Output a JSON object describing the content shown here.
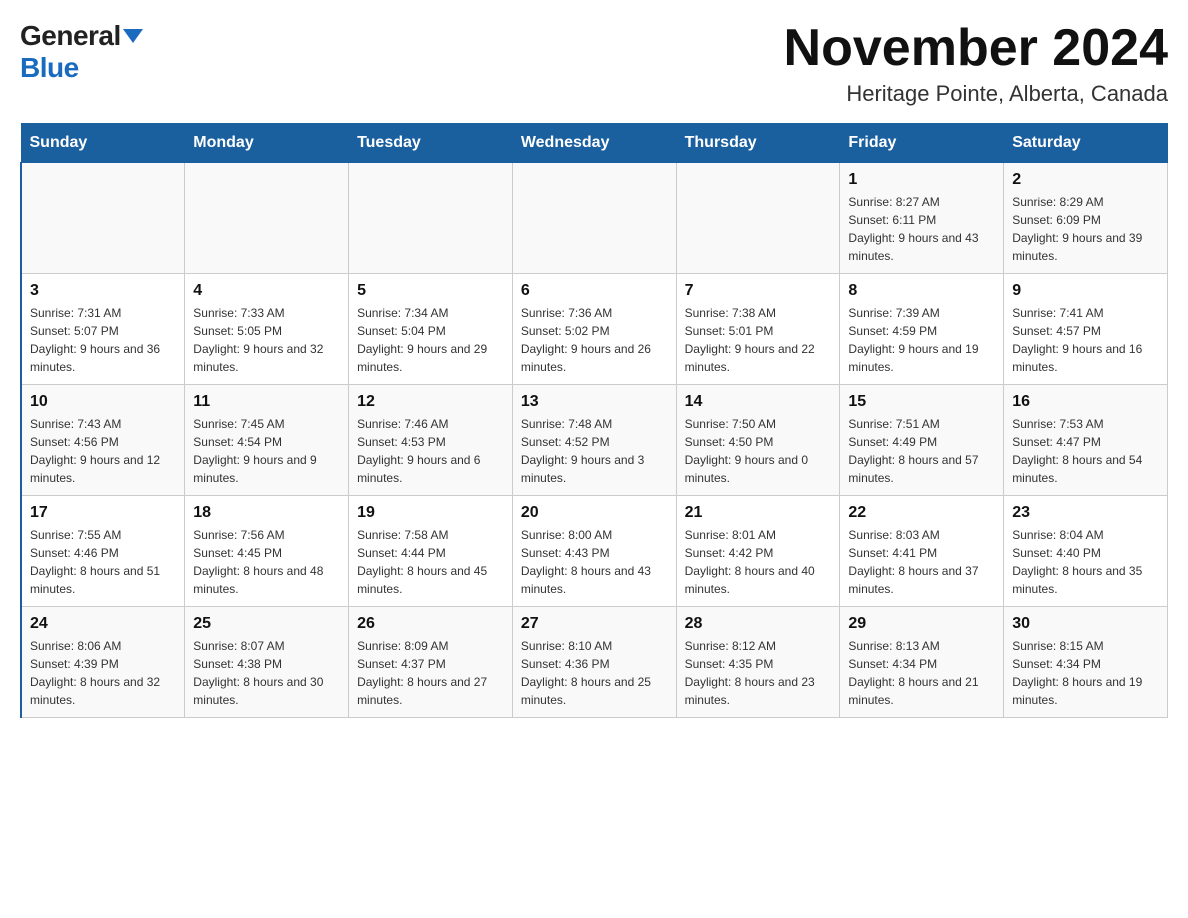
{
  "logo": {
    "general": "General",
    "blue": "Blue"
  },
  "header": {
    "month_year": "November 2024",
    "location": "Heritage Pointe, Alberta, Canada"
  },
  "weekdays": [
    "Sunday",
    "Monday",
    "Tuesday",
    "Wednesday",
    "Thursday",
    "Friday",
    "Saturday"
  ],
  "weeks": [
    [
      {
        "day": "",
        "info": ""
      },
      {
        "day": "",
        "info": ""
      },
      {
        "day": "",
        "info": ""
      },
      {
        "day": "",
        "info": ""
      },
      {
        "day": "",
        "info": ""
      },
      {
        "day": "1",
        "info": "Sunrise: 8:27 AM\nSunset: 6:11 PM\nDaylight: 9 hours and 43 minutes."
      },
      {
        "day": "2",
        "info": "Sunrise: 8:29 AM\nSunset: 6:09 PM\nDaylight: 9 hours and 39 minutes."
      }
    ],
    [
      {
        "day": "3",
        "info": "Sunrise: 7:31 AM\nSunset: 5:07 PM\nDaylight: 9 hours and 36 minutes."
      },
      {
        "day": "4",
        "info": "Sunrise: 7:33 AM\nSunset: 5:05 PM\nDaylight: 9 hours and 32 minutes."
      },
      {
        "day": "5",
        "info": "Sunrise: 7:34 AM\nSunset: 5:04 PM\nDaylight: 9 hours and 29 minutes."
      },
      {
        "day": "6",
        "info": "Sunrise: 7:36 AM\nSunset: 5:02 PM\nDaylight: 9 hours and 26 minutes."
      },
      {
        "day": "7",
        "info": "Sunrise: 7:38 AM\nSunset: 5:01 PM\nDaylight: 9 hours and 22 minutes."
      },
      {
        "day": "8",
        "info": "Sunrise: 7:39 AM\nSunset: 4:59 PM\nDaylight: 9 hours and 19 minutes."
      },
      {
        "day": "9",
        "info": "Sunrise: 7:41 AM\nSunset: 4:57 PM\nDaylight: 9 hours and 16 minutes."
      }
    ],
    [
      {
        "day": "10",
        "info": "Sunrise: 7:43 AM\nSunset: 4:56 PM\nDaylight: 9 hours and 12 minutes."
      },
      {
        "day": "11",
        "info": "Sunrise: 7:45 AM\nSunset: 4:54 PM\nDaylight: 9 hours and 9 minutes."
      },
      {
        "day": "12",
        "info": "Sunrise: 7:46 AM\nSunset: 4:53 PM\nDaylight: 9 hours and 6 minutes."
      },
      {
        "day": "13",
        "info": "Sunrise: 7:48 AM\nSunset: 4:52 PM\nDaylight: 9 hours and 3 minutes."
      },
      {
        "day": "14",
        "info": "Sunrise: 7:50 AM\nSunset: 4:50 PM\nDaylight: 9 hours and 0 minutes."
      },
      {
        "day": "15",
        "info": "Sunrise: 7:51 AM\nSunset: 4:49 PM\nDaylight: 8 hours and 57 minutes."
      },
      {
        "day": "16",
        "info": "Sunrise: 7:53 AM\nSunset: 4:47 PM\nDaylight: 8 hours and 54 minutes."
      }
    ],
    [
      {
        "day": "17",
        "info": "Sunrise: 7:55 AM\nSunset: 4:46 PM\nDaylight: 8 hours and 51 minutes."
      },
      {
        "day": "18",
        "info": "Sunrise: 7:56 AM\nSunset: 4:45 PM\nDaylight: 8 hours and 48 minutes."
      },
      {
        "day": "19",
        "info": "Sunrise: 7:58 AM\nSunset: 4:44 PM\nDaylight: 8 hours and 45 minutes."
      },
      {
        "day": "20",
        "info": "Sunrise: 8:00 AM\nSunset: 4:43 PM\nDaylight: 8 hours and 43 minutes."
      },
      {
        "day": "21",
        "info": "Sunrise: 8:01 AM\nSunset: 4:42 PM\nDaylight: 8 hours and 40 minutes."
      },
      {
        "day": "22",
        "info": "Sunrise: 8:03 AM\nSunset: 4:41 PM\nDaylight: 8 hours and 37 minutes."
      },
      {
        "day": "23",
        "info": "Sunrise: 8:04 AM\nSunset: 4:40 PM\nDaylight: 8 hours and 35 minutes."
      }
    ],
    [
      {
        "day": "24",
        "info": "Sunrise: 8:06 AM\nSunset: 4:39 PM\nDaylight: 8 hours and 32 minutes."
      },
      {
        "day": "25",
        "info": "Sunrise: 8:07 AM\nSunset: 4:38 PM\nDaylight: 8 hours and 30 minutes."
      },
      {
        "day": "26",
        "info": "Sunrise: 8:09 AM\nSunset: 4:37 PM\nDaylight: 8 hours and 27 minutes."
      },
      {
        "day": "27",
        "info": "Sunrise: 8:10 AM\nSunset: 4:36 PM\nDaylight: 8 hours and 25 minutes."
      },
      {
        "day": "28",
        "info": "Sunrise: 8:12 AM\nSunset: 4:35 PM\nDaylight: 8 hours and 23 minutes."
      },
      {
        "day": "29",
        "info": "Sunrise: 8:13 AM\nSunset: 4:34 PM\nDaylight: 8 hours and 21 minutes."
      },
      {
        "day": "30",
        "info": "Sunrise: 8:15 AM\nSunset: 4:34 PM\nDaylight: 8 hours and 19 minutes."
      }
    ]
  ]
}
